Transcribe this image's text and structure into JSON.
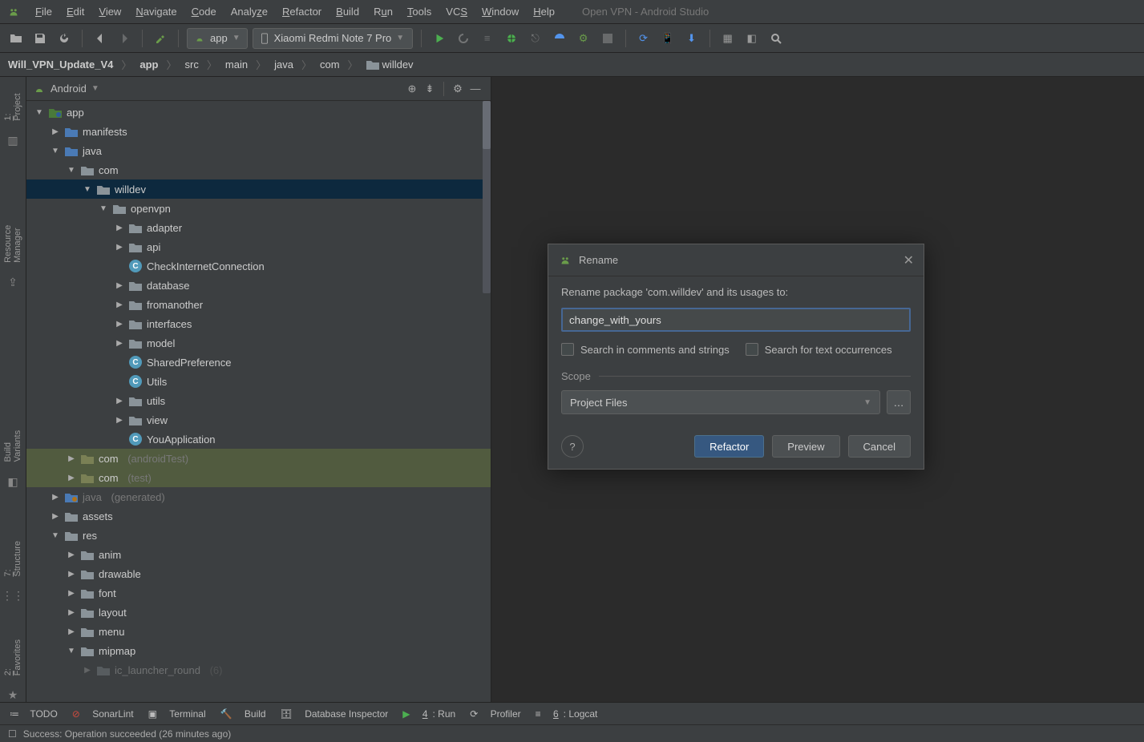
{
  "window": {
    "title": "Open VPN - Android Studio"
  },
  "menu": {
    "items": [
      "File",
      "Edit",
      "View",
      "Navigate",
      "Code",
      "Analyze",
      "Refactor",
      "Build",
      "Run",
      "Tools",
      "VCS",
      "Window",
      "Help"
    ]
  },
  "toolbar": {
    "module_combo": "app",
    "device_combo": "Xiaomi Redmi Note 7 Pro"
  },
  "breadcrumb": {
    "project": "Will_VPN_Update_V4",
    "parts": [
      "app",
      "src",
      "main",
      "java",
      "com",
      "willdev"
    ]
  },
  "projectPanel": {
    "mode": "Android",
    "tree": {
      "app": "app",
      "manifests": "manifests",
      "java": "java",
      "com": "com",
      "willdev": "willdev",
      "openvpn": "openvpn",
      "adapter": "adapter",
      "api": "api",
      "checkinternet": "CheckInternetConnection",
      "database": "database",
      "fromanother": "fromanother",
      "interfaces": "interfaces",
      "model": "model",
      "sharedpref": "SharedPreference",
      "utils_class": "Utils",
      "utils_pkg": "utils",
      "view": "view",
      "youapp": "YouApplication",
      "com_at": "com",
      "com_at_suffix": "(androidTest)",
      "com_test": "com",
      "com_test_suffix": "(test)",
      "java_gen": "java",
      "java_gen_suffix": "(generated)",
      "assets": "assets",
      "res": "res",
      "anim": "anim",
      "drawable": "drawable",
      "font": "font",
      "layout": "layout",
      "menu": "menu",
      "mipmap": "mipmap",
      "ic_launcher": "ic_launcher_round",
      "ic_launcher_suffix": "(6)"
    }
  },
  "sidebar": {
    "project": "1: Project",
    "resmgr": "Resource Manager",
    "buildvar": "Build Variants",
    "structure": "7: Structure",
    "favorites": "2: Favorites"
  },
  "dialog": {
    "title": "Rename",
    "message": "Rename package 'com.willdev' and its usages to:",
    "input": "change_with_yours",
    "chk1": "Search in comments and strings",
    "chk2": "Search for text occurrences",
    "scope_label": "Scope",
    "scope_value": "Project Files",
    "btn_refactor": "Refactor",
    "btn_preview": "Preview",
    "btn_cancel": "Cancel"
  },
  "bottom": {
    "todo": "TODO",
    "sonar": "SonarLint",
    "terminal": "Terminal",
    "build": "Build",
    "db": "Database Inspector",
    "run": "4: Run",
    "profiler": "Profiler",
    "logcat": "6: Logcat"
  },
  "status": {
    "msg": "Success: Operation succeeded (26 minutes ago)"
  }
}
